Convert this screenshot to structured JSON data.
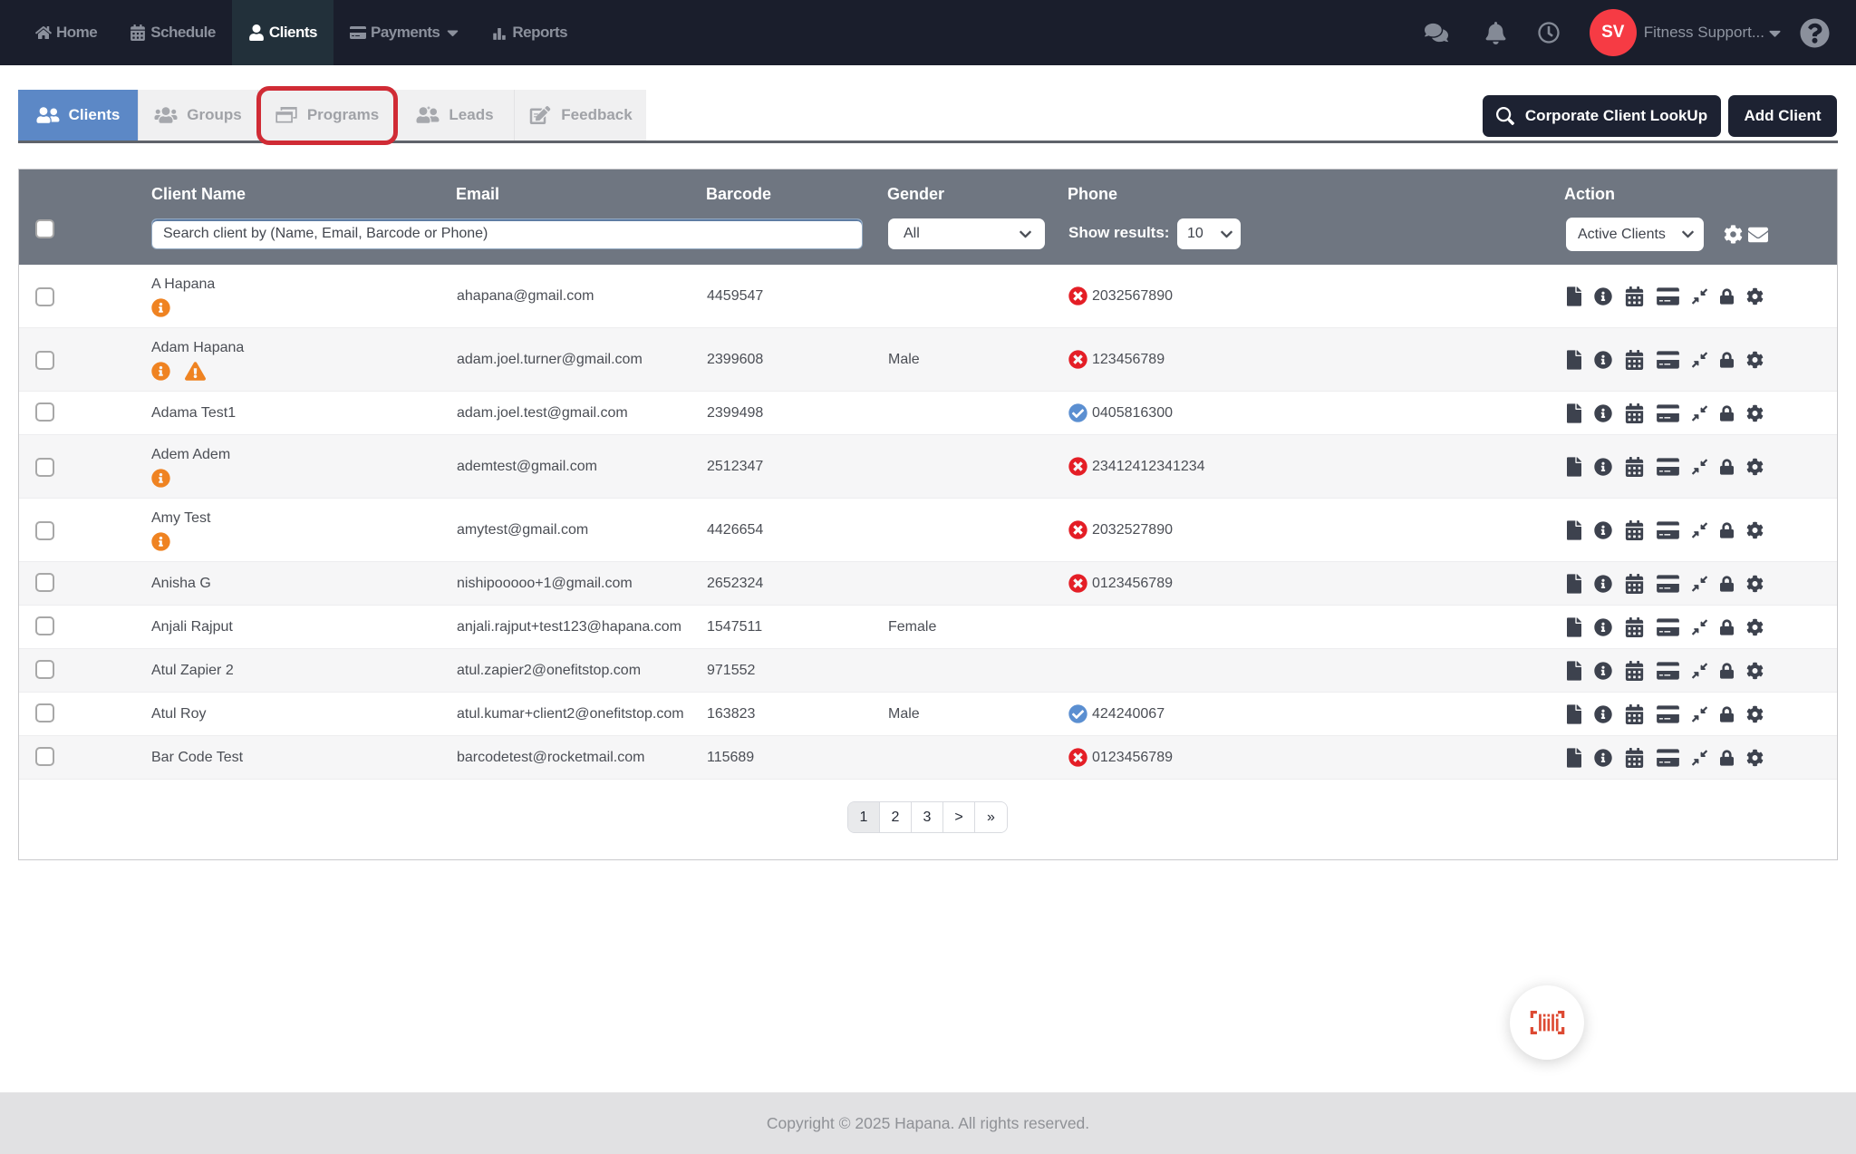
{
  "navbar": {
    "items": [
      {
        "label": "Home",
        "icon": "home-icon",
        "active": false
      },
      {
        "label": "Schedule",
        "icon": "calendar-icon",
        "active": false
      },
      {
        "label": "Clients",
        "icon": "user-icon",
        "active": true
      },
      {
        "label": "Payments",
        "icon": "credit-card-icon",
        "active": false,
        "has_caret": true
      },
      {
        "label": "Reports",
        "icon": "chart-bar-icon",
        "active": false
      }
    ],
    "right_icons": [
      "chat-icon",
      "bell-icon",
      "clock-icon"
    ],
    "user": {
      "initials": "SV",
      "name": "Fitness Support...",
      "avatar_color": "#f63b44"
    }
  },
  "tabs": [
    {
      "label": "Clients",
      "icon": "user-friends-icon",
      "active": true
    },
    {
      "label": "Groups",
      "icon": "users-icon",
      "active": false
    },
    {
      "label": "Programs",
      "icon": "window-icon",
      "active": false,
      "annotated": true
    },
    {
      "label": "Leads",
      "icon": "leads-icon",
      "active": false
    },
    {
      "label": "Feedback",
      "icon": "feedback-icon",
      "active": false
    }
  ],
  "toolbar": {
    "corporate_lookup_label": "Corporate Client LookUp",
    "add_client_label": "Add Client"
  },
  "table": {
    "columns": [
      "Client Name",
      "Email",
      "Barcode",
      "Gender",
      "Phone",
      "Action"
    ],
    "filters": {
      "search_placeholder": "Search client by (Name, Email, Barcode or Phone)",
      "gender_value": "All",
      "show_results_label": "Show results:",
      "show_results_value": "10",
      "action_filter_value": "Active Clients"
    },
    "action_icons": [
      "file-icon",
      "info-circle-icon",
      "calendar-grid-icon",
      "credit-card-icon",
      "compress-icon",
      "lock-icon",
      "gear-icon"
    ],
    "rows": [
      {
        "name": "A Hapana",
        "flags": [
          "info"
        ],
        "email": "ahapana@gmail.com",
        "barcode": "4459547",
        "gender": "",
        "phone_status": "invalid",
        "phone": "2032567890"
      },
      {
        "name": "Adam Hapana",
        "flags": [
          "info",
          "warning"
        ],
        "email": "adam.joel.turner@gmail.com",
        "barcode": "2399608",
        "gender": "Male",
        "phone_status": "invalid",
        "phone": "123456789"
      },
      {
        "name": "Adama Test1",
        "flags": [],
        "email": "adam.joel.test@gmail.com",
        "barcode": "2399498",
        "gender": "",
        "phone_status": "verified",
        "phone": "0405816300"
      },
      {
        "name": "Adem Adem",
        "flags": [
          "info"
        ],
        "email": "ademtest@gmail.com",
        "barcode": "2512347",
        "gender": "",
        "phone_status": "invalid",
        "phone": "23412412341234"
      },
      {
        "name": "Amy Test",
        "flags": [
          "info"
        ],
        "email": "amytest@gmail.com",
        "barcode": "4426654",
        "gender": "",
        "phone_status": "invalid",
        "phone": "2032527890"
      },
      {
        "name": "Anisha G",
        "flags": [],
        "email": "nishipooooo+1@gmail.com",
        "barcode": "2652324",
        "gender": "",
        "phone_status": "invalid",
        "phone": "0123456789"
      },
      {
        "name": "Anjali Rajput",
        "flags": [],
        "email": "anjali.rajput+test123@hapana.com",
        "barcode": "1547511",
        "gender": "Female",
        "phone_status": null,
        "phone": ""
      },
      {
        "name": "Atul Zapier 2",
        "flags": [],
        "email": "atul.zapier2@onefitstop.com",
        "barcode": "971552",
        "gender": "",
        "phone_status": null,
        "phone": ""
      },
      {
        "name": "Atul Roy",
        "flags": [],
        "email": "atul.kumar+client2@onefitstop.com",
        "barcode": "163823",
        "gender": "Male",
        "phone_status": "verified",
        "phone": "424240067"
      },
      {
        "name": "Bar Code Test",
        "flags": [],
        "email": "barcodetest@rocketmail.com",
        "barcode": "115689",
        "gender": "",
        "phone_status": "invalid",
        "phone": "0123456789"
      }
    ]
  },
  "pagination": {
    "pages": [
      "1",
      "2",
      "3",
      ">",
      "»"
    ],
    "active_page": "1"
  },
  "footer": {
    "copyright": "Copyright © 2025 Hapana. All rights reserved."
  },
  "colors": {
    "navbar_bg": "#1a1e2c",
    "active_nav_bg": "#22303a",
    "tab_active_blue": "#5c88c6",
    "table_header_gray": "#6f7681",
    "invalid_red": "#e41e26",
    "verified_blue": "#5b8fd1",
    "info_orange": "#ef8322",
    "warning_orange": "#ef8322",
    "annotation_red": "#d02b35",
    "fab_icon_red": "#dd4a33",
    "button_navy": "#1d2232"
  }
}
